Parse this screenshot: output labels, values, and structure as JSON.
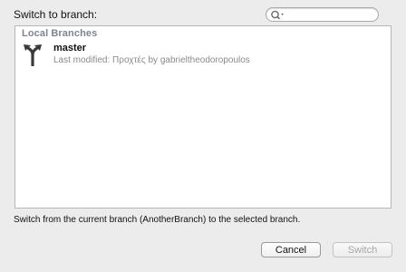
{
  "dialog": {
    "title": "Switch to branch:",
    "search": {
      "value": "",
      "placeholder": ""
    },
    "list": {
      "group_header": "Local Branches",
      "branches": [
        {
          "name": "master",
          "detail": "Last modified: Προχτές by gabrieltheodoropoulos",
          "icon": "branch-icon"
        }
      ]
    },
    "hint": "Switch from the current branch (AnotherBranch) to the selected branch.",
    "buttons": {
      "cancel": "Cancel",
      "switch": "Switch"
    }
  }
}
